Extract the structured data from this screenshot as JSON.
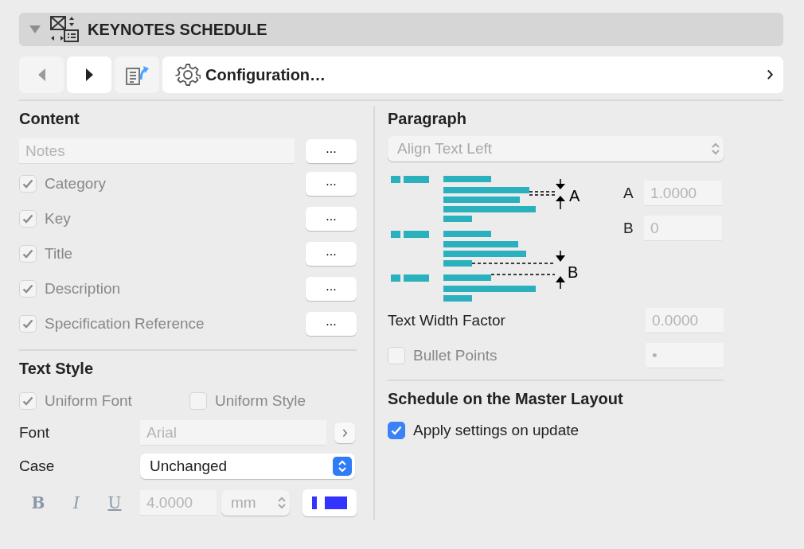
{
  "panel": {
    "title": "KEYNOTES SCHEDULE",
    "expanded": true
  },
  "toolbar": {
    "nav": [
      {
        "kind": "back",
        "disabled": true
      },
      {
        "kind": "forward",
        "disabled": false
      }
    ],
    "configuration": "Configuration…"
  },
  "content": {
    "heading": "Content",
    "rows": [
      {
        "kind": "field",
        "value": "Notes",
        "disabled": true,
        "button": "..."
      },
      {
        "kind": "checkbox",
        "label": "Category",
        "checked": true,
        "disabled": true,
        "button": "..."
      },
      {
        "kind": "checkbox",
        "label": "Key",
        "checked": true,
        "disabled": true,
        "button": "..."
      },
      {
        "kind": "checkbox",
        "label": "Title",
        "checked": true,
        "disabled": true,
        "button": "..."
      },
      {
        "kind": "checkbox",
        "label": "Description",
        "checked": true,
        "disabled": true,
        "button": "..."
      },
      {
        "kind": "checkbox",
        "label": "Specification Reference",
        "checked": true,
        "disabled": true,
        "button": "..."
      }
    ]
  },
  "text_style": {
    "heading": "Text Style",
    "options": [
      {
        "label": "Uniform Font",
        "checked": true,
        "disabled": true
      },
      {
        "label": "Uniform Style",
        "checked": false,
        "disabled": true
      }
    ],
    "font": {
      "label": "Font",
      "value": "Arial",
      "disabled": true
    },
    "case": {
      "label": "Case",
      "value": "Unchanged"
    },
    "styles": [
      {
        "kind": "bold",
        "label": "B"
      },
      {
        "kind": "italic",
        "label": "I"
      },
      {
        "kind": "underline",
        "label": "U"
      }
    ],
    "size": {
      "value": "4.0000",
      "disabled": true
    },
    "unit": "mm"
  },
  "paragraph": {
    "heading": "Paragraph",
    "alignment": {
      "value": "Align Text Left",
      "disabled": true
    },
    "diagram_labels": [
      "A",
      "B"
    ],
    "spacing": [
      {
        "label": "A",
        "value": "1.0000"
      },
      {
        "label": "B",
        "value": "0"
      }
    ],
    "width_factor": {
      "label": "Text Width Factor",
      "value": "0.0000"
    },
    "bullet": {
      "label": "Bullet Points",
      "checked": false,
      "disabled": true,
      "value": "•"
    }
  },
  "master": {
    "heading": "Schedule on the Master Layout",
    "apply": {
      "label": "Apply settings on update",
      "checked": true,
      "disabled": false
    }
  }
}
